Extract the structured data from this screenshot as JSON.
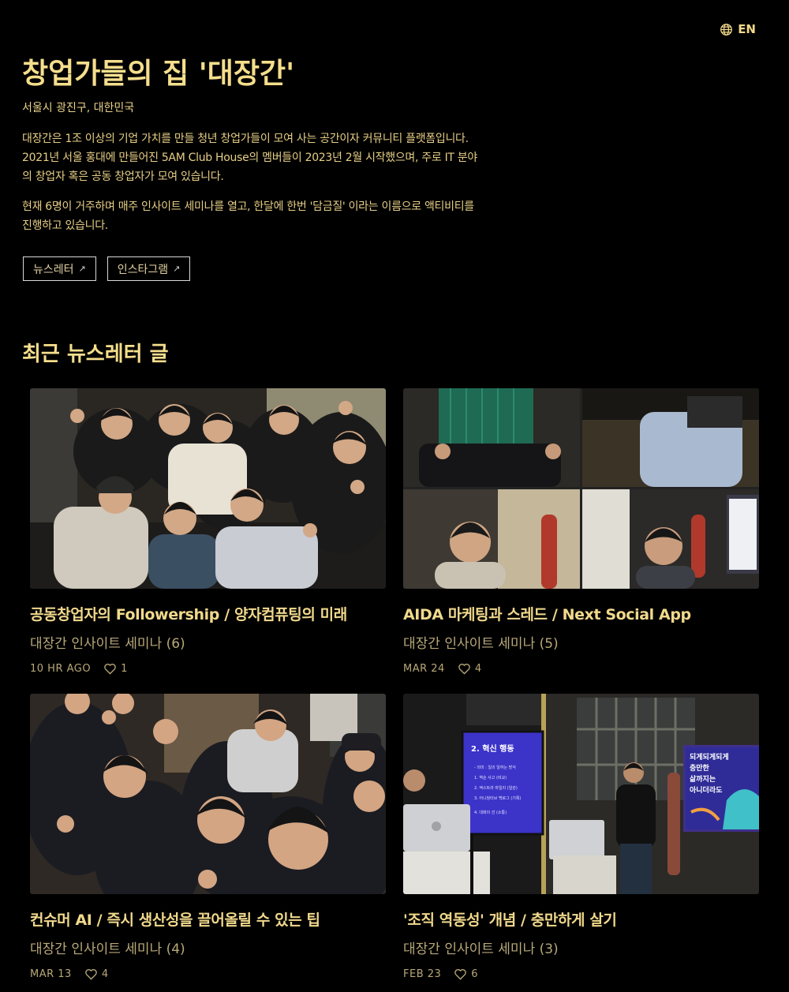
{
  "lang": {
    "label": "EN",
    "icon": "globe-icon"
  },
  "hero": {
    "title": "창업가들의 집 '대장간'",
    "location": "서울시 광진구, 대한민국",
    "paragraph1": "대장간은 1조 이상의 기업 가치를 만들 청년 창업가들이 모여 사는 공간이자 커뮤니티 플랫폼입니다. 2021년 서울 홍대에 만들어진 5AM Club House의 멤버들이 2023년 2월 시작했으며, 주로 IT 분야의 창업자 혹은 공동 창업자가 모여 있습니다.",
    "paragraph2": "현재 6명이 거주하며 매주 인사이트 세미나를 열고, 한달에 한번 '담금질' 이라는 이름으로 액티비티를 진행하고 있습니다."
  },
  "links": {
    "newsletter": "뉴스레터",
    "instagram": "인스타그램",
    "arrow": "↗"
  },
  "section": {
    "title": "최근 뉴스레터 글"
  },
  "posts": [
    {
      "title": "공동창업자의 Followership / 양자컴퓨팅의 미래",
      "series": "대장간 인사이트 세미나 (6)",
      "date": "10 HR AGO",
      "likes": "1"
    },
    {
      "title": "AIDA 마케팅과 스레드 / Next Social App",
      "series": "대장간 인사이트 세미나 (5)",
      "date": "MAR 24",
      "likes": "4"
    },
    {
      "title": "컨슈머 AI / 즉시 생산성을 끌어올릴 수 있는 팁",
      "series": "대장간 인사이트 세미나 (4)",
      "date": "MAR 13",
      "likes": "4"
    },
    {
      "title": "'조직 역동성' 개념 / 충만하게 살기",
      "series": "대장간 인사이트 세미나 (3)",
      "date": "FEB 23",
      "likes": "6"
    }
  ],
  "slides": {
    "left_title": "2. 혁신 행동",
    "left_lines": [
      "- 의미 : 일의 일하는 방식",
      "1. 역순 사고 (비교)",
      "2. 엑스트라 마일리 (일관)",
      "3. 어니씽터브 백로그 (기록)",
      "4. 대화의 선 (소통)"
    ],
    "right_lines": [
      "되게되게되게",
      "충만한",
      "삶까지는",
      "아니더라도"
    ]
  },
  "colors": {
    "accent": "#f0d98a",
    "background": "#000000",
    "muted": "#b8a878"
  }
}
